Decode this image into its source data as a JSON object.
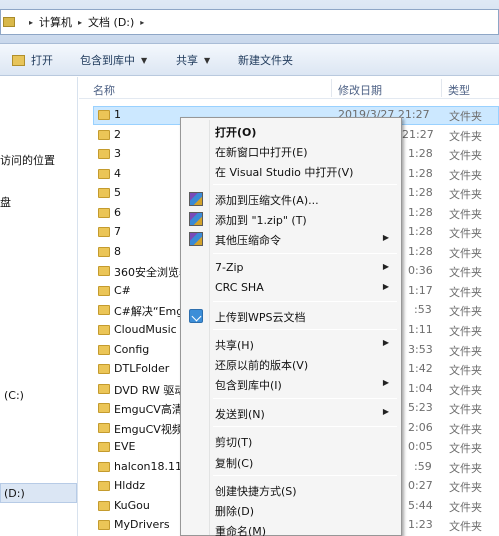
{
  "address": {
    "crumbs": [
      "计算机",
      "文档 (D:)"
    ],
    "crumb_sep": "▸",
    "dropdown_arrow": "▸"
  },
  "toolbar": {
    "open_label": "打开",
    "library_label": "包含到库中",
    "share_label": "共享",
    "newfolder_label": "新建文件夹",
    "arrow": "▼"
  },
  "nav": {
    "items": [
      {
        "label": "访问的位置"
      },
      {
        "label": "盘"
      },
      {
        "label": "(C:)"
      },
      {
        "label": "(D:)"
      }
    ]
  },
  "columns": {
    "name": "名称",
    "date": "修改日期",
    "type": "类型"
  },
  "files": [
    {
      "name": "1",
      "date": "2019/3/27 21:27",
      "type": "文件夹"
    },
    {
      "name": "2",
      "date": "21:27",
      "type": "文件夹"
    },
    {
      "name": "3",
      "date": "1:28",
      "type": "文件夹"
    },
    {
      "name": "4",
      "date": "1:28",
      "type": "文件夹"
    },
    {
      "name": "5",
      "date": "1:28",
      "type": "文件夹"
    },
    {
      "name": "6",
      "date": "1:28",
      "type": "文件夹"
    },
    {
      "name": "7",
      "date": "1:28",
      "type": "文件夹"
    },
    {
      "name": "8",
      "date": "1:28",
      "type": "文件夹"
    },
    {
      "name": "360安全浏览器",
      "date": "0:36",
      "type": "文件夹"
    },
    {
      "name": "C#",
      "date": "1:17",
      "type": "文件夹"
    },
    {
      "name": "C#解决“Emgu",
      "date": ":53",
      "type": "文件夹"
    },
    {
      "name": "CloudMusic",
      "date": "1:11",
      "type": "文件夹"
    },
    {
      "name": "Config",
      "date": "3:53",
      "type": "文件夹"
    },
    {
      "name": "DTLFolder",
      "date": "1:42",
      "type": "文件夹"
    },
    {
      "name": "DVD RW 驱动器",
      "date": "1:04",
      "type": "文件夹"
    },
    {
      "name": "EmguCV高清",
      "date": "5:23",
      "type": "文件夹"
    },
    {
      "name": "EmguCV视频",
      "date": "2:06",
      "type": "文件夹"
    },
    {
      "name": "EVE",
      "date": "0:05",
      "type": "文件夹"
    },
    {
      "name": "halcon18.11.",
      "date": ":59",
      "type": "文件夹"
    },
    {
      "name": "Hlddz",
      "date": "0:27",
      "type": "文件夹"
    },
    {
      "name": "KuGou",
      "date": "5:44",
      "type": "文件夹"
    },
    {
      "name": "MyDrivers",
      "date": "1:23",
      "type": "文件夹"
    }
  ],
  "context_menu": {
    "items": [
      {
        "label": "打开(O)",
        "bold": true,
        "icon": "",
        "submenu": false
      },
      {
        "label": "在新窗口中打开(E)",
        "icon": "",
        "submenu": false
      },
      {
        "label": "在 Visual Studio 中打开(V)",
        "icon": "",
        "submenu": false
      },
      {
        "label": "添加到压缩文件(A)...",
        "icon": "winrar-icon",
        "submenu": false
      },
      {
        "label": "添加到 \"1.zip\" (T)",
        "icon": "winrar-icon",
        "submenu": false
      },
      {
        "label": "其他压缩命令",
        "icon": "winrar-icon",
        "submenu": true
      },
      {
        "label": "7-Zip",
        "icon": "",
        "submenu": true
      },
      {
        "label": "CRC SHA",
        "icon": "",
        "submenu": true
      },
      {
        "label": "上传到WPS云文档",
        "icon": "wps-cloud-icon",
        "submenu": false
      },
      {
        "label": "共享(H)",
        "icon": "",
        "submenu": true
      },
      {
        "label": "还原以前的版本(V)",
        "icon": "",
        "submenu": false
      },
      {
        "label": "包含到库中(I)",
        "icon": "",
        "submenu": true
      },
      {
        "label": "发送到(N)",
        "icon": "",
        "submenu": true
      },
      {
        "label": "剪切(T)",
        "icon": "",
        "submenu": false
      },
      {
        "label": "复制(C)",
        "icon": "",
        "submenu": false
      },
      {
        "label": "创建快捷方式(S)",
        "icon": "",
        "submenu": false
      },
      {
        "label": "删除(D)",
        "icon": "",
        "submenu": false
      },
      {
        "label": "重命名(M)",
        "icon": "",
        "submenu": false
      }
    ],
    "submenu_arrow": "▶"
  },
  "colors": {
    "selection": "#cce8ff",
    "folder": "#ebc557",
    "menu_bg": "#f5f5f5",
    "toolbar_text": "#1e395b"
  }
}
